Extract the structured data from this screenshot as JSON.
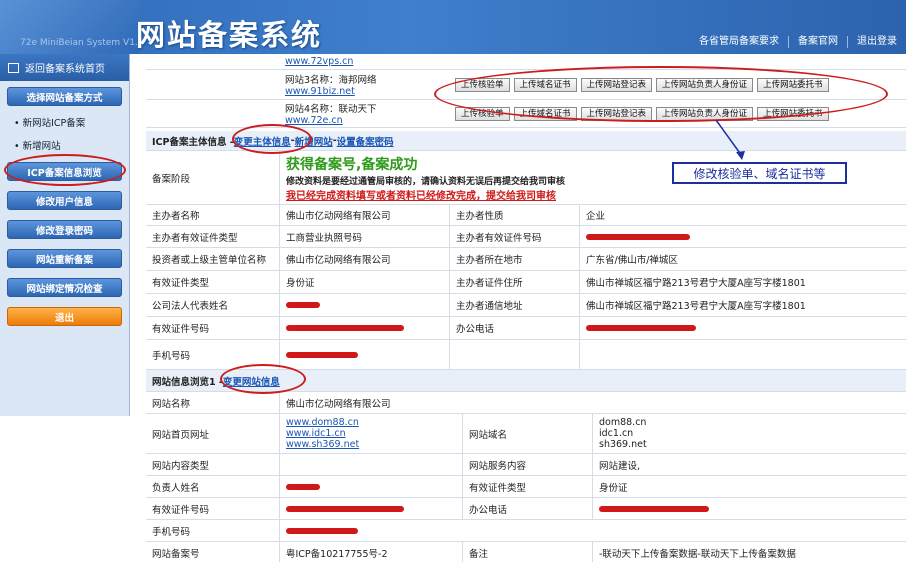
{
  "header": {
    "system_en": "72e MiniBeian System V1.0",
    "title": "网站备案系统",
    "nav": [
      "各省管局备案要求",
      "备案官网",
      "退出登录"
    ]
  },
  "sidebar": {
    "home": "返回备案系统首页",
    "choose_method": "选择网站备案方式",
    "links": [
      "• 新网站ICP备案",
      "• 新增网站"
    ],
    "buttons": [
      "ICP备案信息浏览",
      "修改用户信息",
      "修改登录密码",
      "网站重新备案",
      "网站绑定情况检查"
    ],
    "exit": "退出"
  },
  "top_sites": {
    "site2_url": "www.72vps.cn",
    "site3_label": "网站3名称：海邦网络",
    "site3_url": "www.91biz.net",
    "site4_label": "网站4名称：联动天下",
    "site4_url": "www.72e.cn",
    "upload_buttons": [
      "上传核验单",
      "上传域名证书",
      "上传网站登记表",
      "上传网站负责人身份证",
      "上传网站委托书"
    ]
  },
  "icp_section": {
    "title": "ICP备案主体信息 - ",
    "change_link": "变更主体信息",
    "sep": " - ",
    "add_site": "新增网站",
    "set_pwd": "设置备案密码"
  },
  "stage": {
    "label": "备案阶段",
    "success": "获得备案号,备案成功",
    "note": "修改资料是要经过通管局审核的，请确认资料无误后再提交给我司审核",
    "link": "我已经完成资料填写或者资料已经修改完成，提交给我司审核"
  },
  "annotation": "修改核验单、域名证书等",
  "main_rows": [
    {
      "l1": "主办者名称",
      "v1": "佛山市亿动网络有限公司",
      "l2": "主办者性质",
      "v2": "企业"
    },
    {
      "l1": "主办者有效证件类型",
      "v1": "工商营业执照号码",
      "l2": "主办者有效证件号码",
      "v2": ""
    },
    {
      "l1": "投资者或上级主管单位名称",
      "v1": "佛山市亿动网络有限公司",
      "l2": "主办者所在地市",
      "v2": "广东省/佛山市/禅城区"
    },
    {
      "l1": "有效证件类型",
      "v1": "身份证",
      "l2": "主办者证件住所",
      "v2": "佛山市禅城区福宁路213号君宁大厦A座写字楼1801"
    },
    {
      "l1": "公司法人代表姓名",
      "v1": "",
      "l2": "主办者通信地址",
      "v2": "佛山市禅城区福宁路213号君宁大厦A座写字楼1801"
    },
    {
      "l1": "有效证件号码",
      "v1": "",
      "l2": "办公电话",
      "v2": ""
    },
    {
      "l1": "手机号码",
      "v1": "",
      "l2": "",
      "v2": ""
    }
  ],
  "site_section": {
    "title": "网站信息浏览1 - ",
    "change_link": "变更网站信息"
  },
  "site_rows": {
    "name_label": "网站名称",
    "name_value": "佛山市亿动网络有限公司",
    "home_label": "网站首页网址",
    "home_urls": [
      "www.dom88.cn",
      "www.idc1.cn",
      "www.sh369.net"
    ],
    "domain_label": "网站域名",
    "domains": [
      "dom88.cn",
      "idc1.cn",
      "sh369.net"
    ],
    "type_label": "网站内容类型",
    "service_label": "网站服务内容",
    "service_value": "网站建设,",
    "owner_label": "负责人姓名",
    "id_type_label": "有效证件类型",
    "id_type_value": "身份证",
    "id_no_label": "有效证件号码",
    "phone_label": "办公电话",
    "mobile_label": "手机号码",
    "record_label": "网站备案号",
    "record_value": "粤ICP备10217755号-2",
    "remark_label": "备注",
    "remark_value": "-联动天下上传备案数据-联动天下上传备案数据"
  }
}
